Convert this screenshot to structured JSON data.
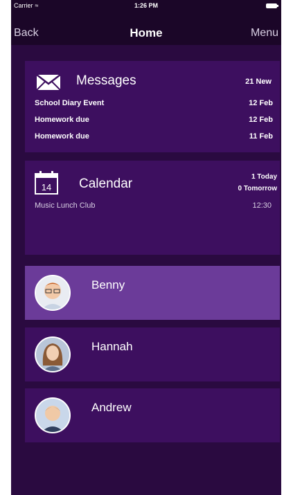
{
  "status_bar": {
    "carrier": "Carrier",
    "time": "1:26 PM"
  },
  "nav": {
    "back_label": "Back",
    "title": "Home",
    "menu_label": "Menu"
  },
  "messages": {
    "title": "Messages",
    "new_count": "21 New",
    "items": [
      {
        "subject": "School Diary Event",
        "date": "12 Feb"
      },
      {
        "subject": "Homework due",
        "date": "12 Feb"
      },
      {
        "subject": "Homework due",
        "date": "11 Feb"
      }
    ]
  },
  "calendar": {
    "title": "Calendar",
    "icon_day": "14",
    "today_count": "1 Today",
    "tomorrow_count": "0 Tomorrow",
    "event": "Music Lunch Club",
    "event_time": "12:30"
  },
  "children": [
    {
      "name": "Benny",
      "selected": true
    },
    {
      "name": "Hannah",
      "selected": false
    },
    {
      "name": "Andrew",
      "selected": false
    }
  ],
  "colors": {
    "background": "#2a0a40",
    "card": "#3d0f5f",
    "selected_row": "#6b3b99",
    "nav_bar": "#1b0628"
  }
}
